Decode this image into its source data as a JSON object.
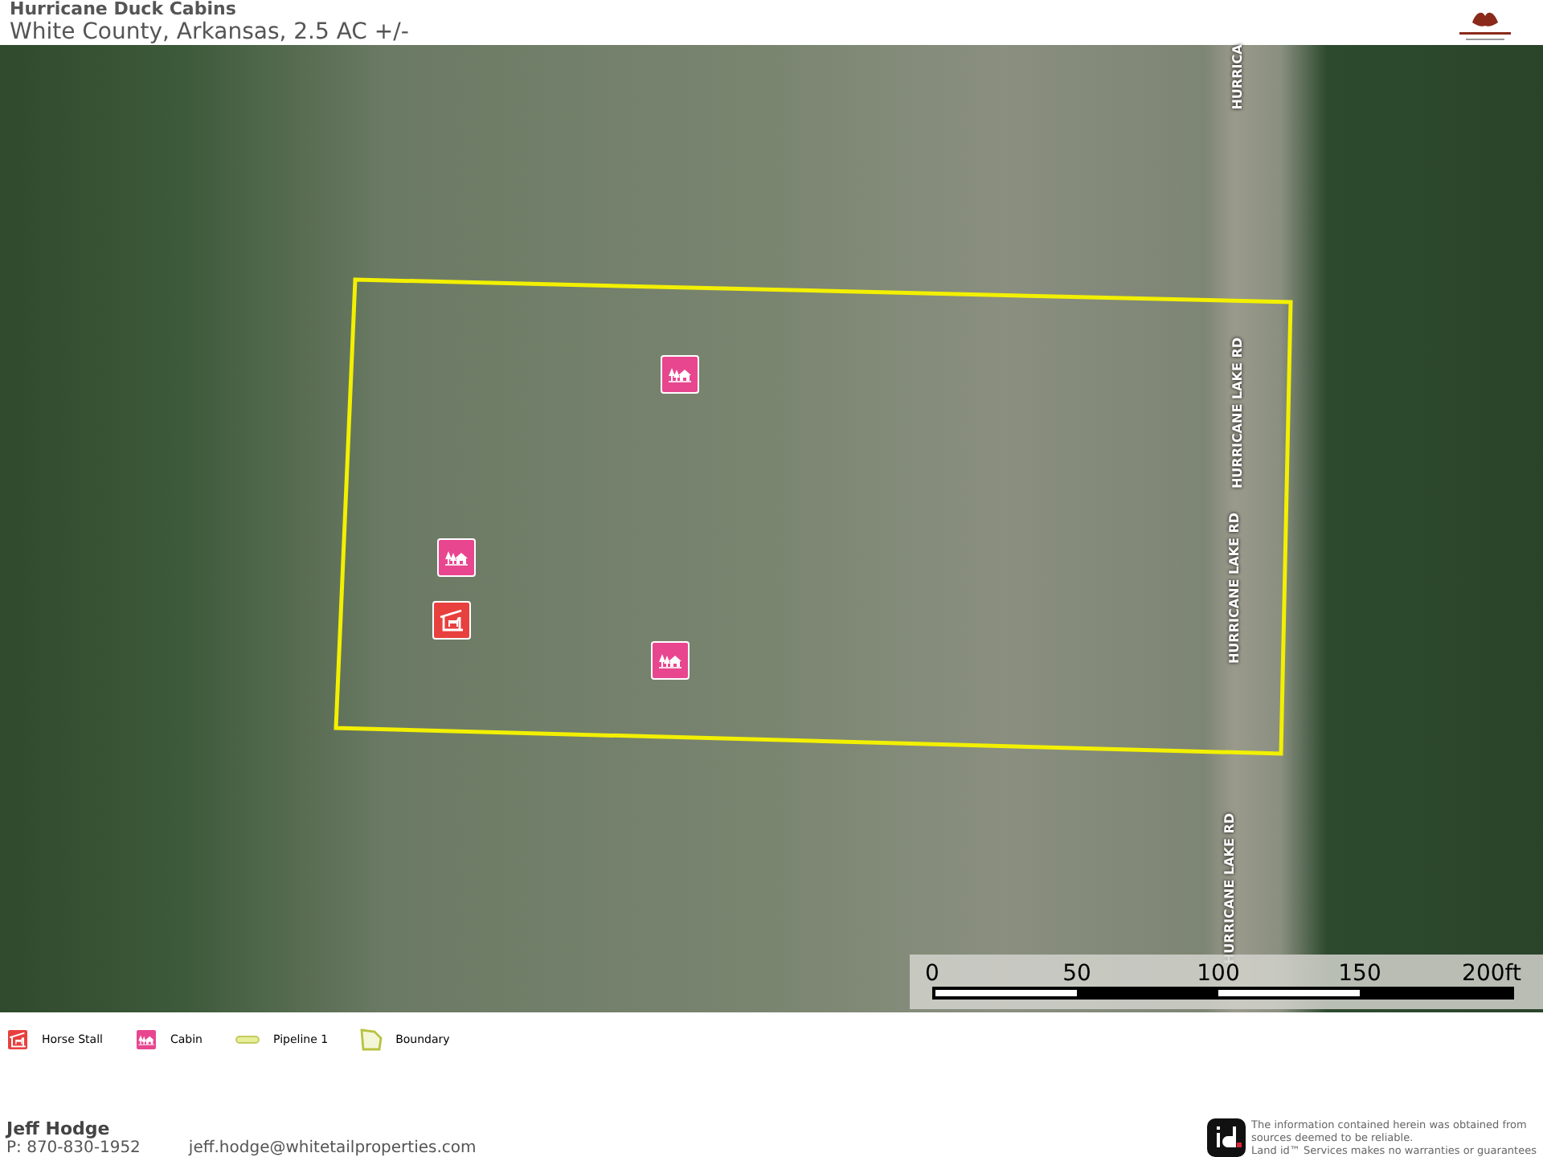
{
  "header": {
    "title": "Hurricane Duck Cabins",
    "subtitle": "White County, Arkansas, 2.5 AC +/-"
  },
  "map": {
    "markers": [
      {
        "kind": "cabin"
      },
      {
        "kind": "cabin"
      },
      {
        "kind": "horse_stall"
      },
      {
        "kind": "cabin"
      }
    ],
    "road_labels": [
      "HURRICA",
      "HURRICANE LAKE RD",
      "HURRICANE LAKE RD",
      "HURRICANE LAKE RD"
    ],
    "scale": {
      "ticks": [
        "0",
        "50",
        "100",
        "150",
        "200ft"
      ]
    }
  },
  "legend": [
    {
      "kind": "horse_stall",
      "label": "Horse Stall"
    },
    {
      "kind": "cabin",
      "label": "Cabin"
    },
    {
      "kind": "pipeline",
      "label": "Pipeline 1"
    },
    {
      "kind": "boundary",
      "label": "Boundary"
    }
  ],
  "footer": {
    "agent": "Jeff Hodge",
    "phone": "P: 870-830-1952",
    "email": "jeff.hodge@whitetailproperties.com",
    "disclaimer": [
      "The information contained herein was obtained from",
      "sources deemed to be reliable.",
      "Land id™ Services makes no warranties or guarantees"
    ]
  }
}
